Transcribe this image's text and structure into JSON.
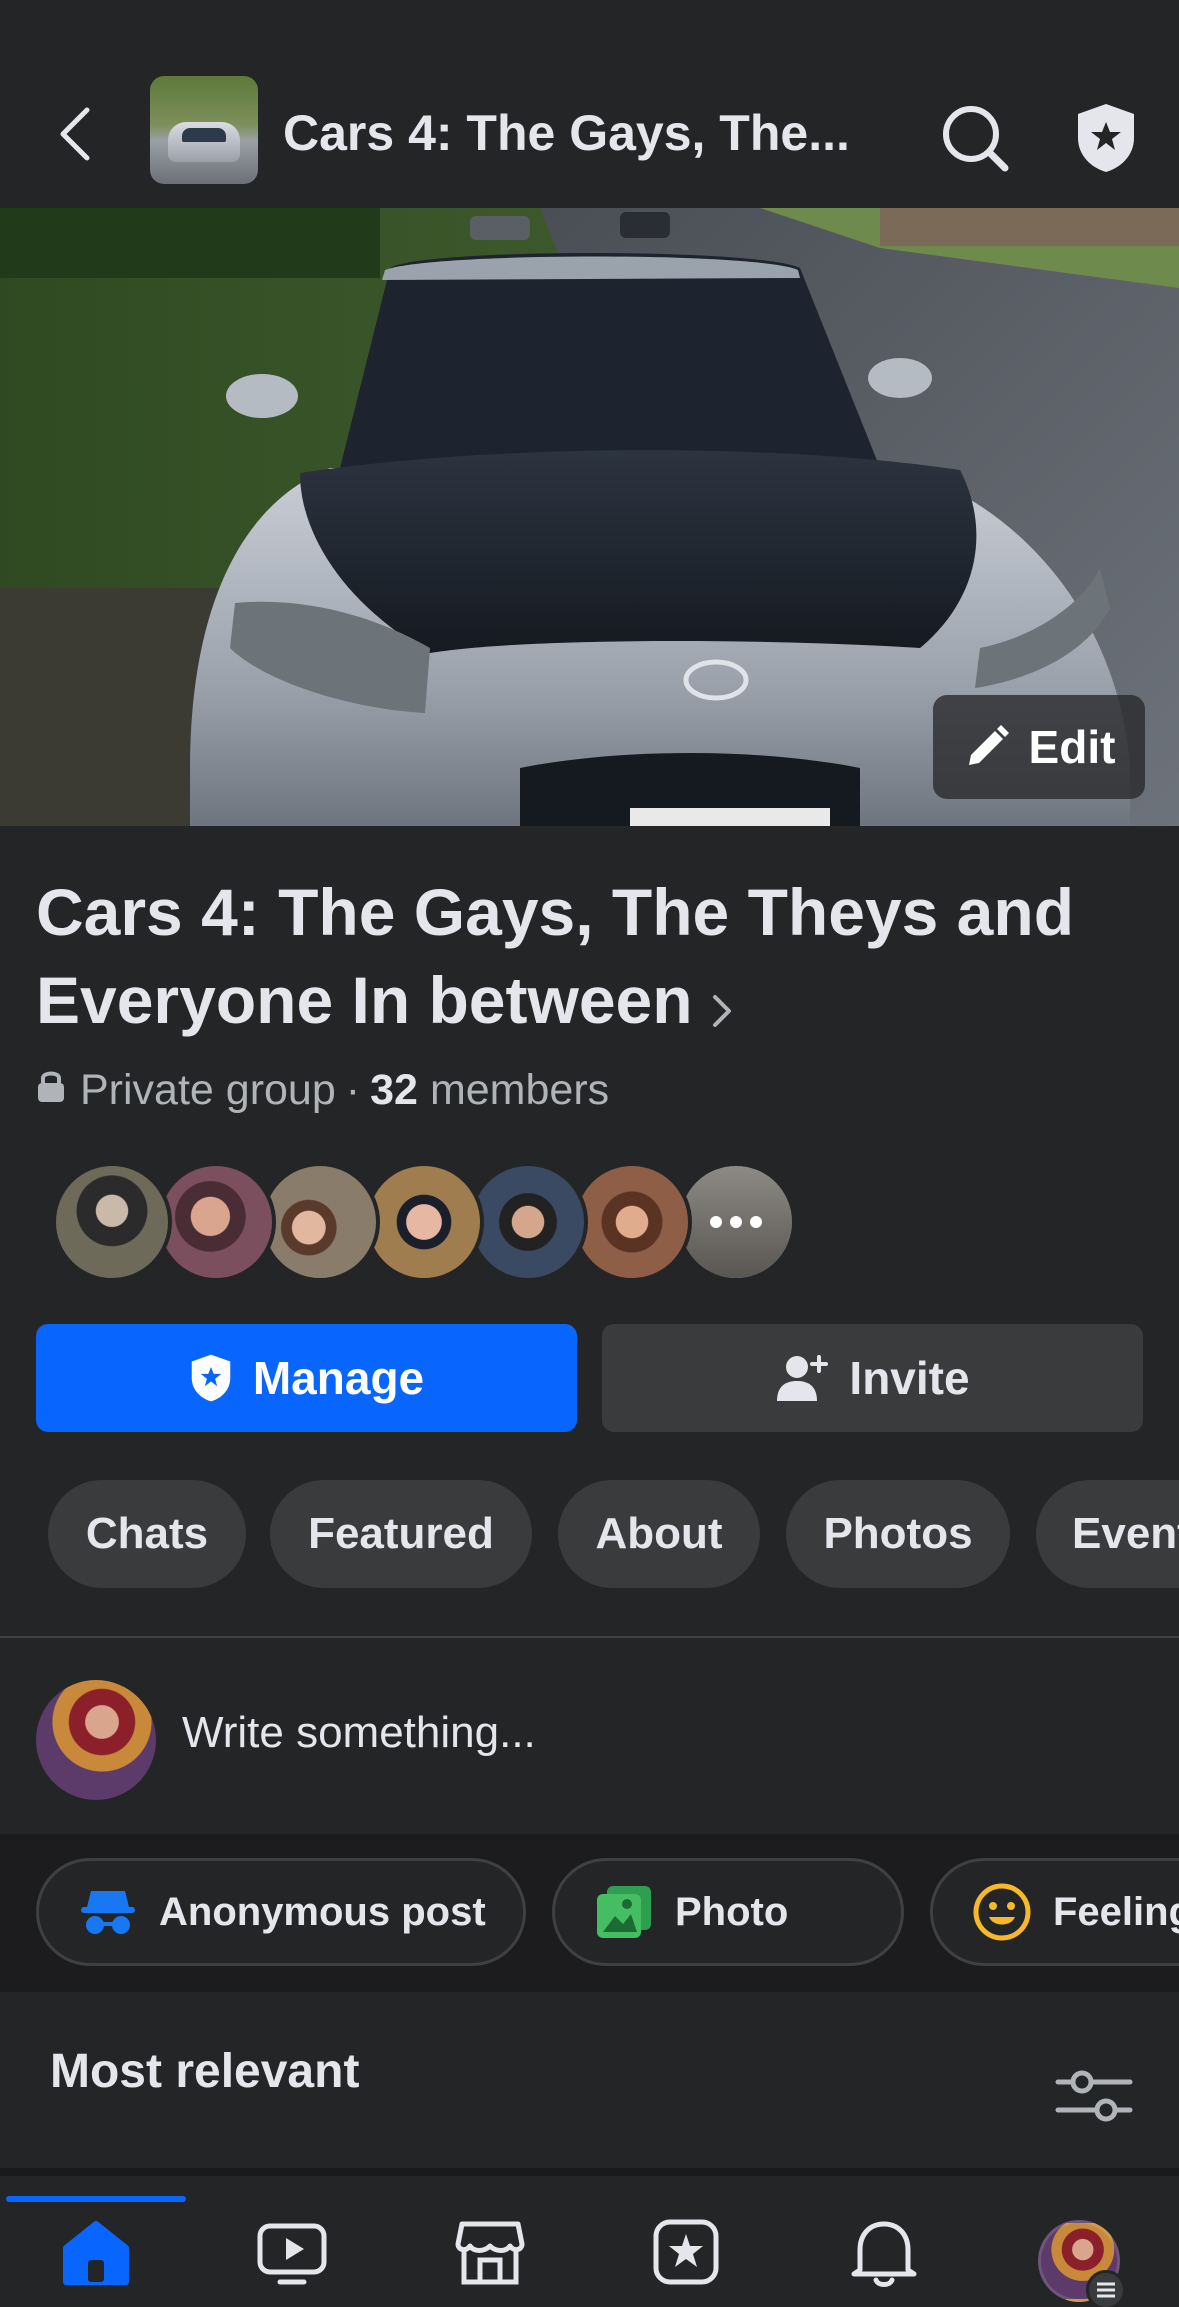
{
  "header": {
    "title": "Cars 4: The Gays, The..."
  },
  "cover": {
    "edit_label": "Edit"
  },
  "group": {
    "name": "Cars 4: The Gays, The Theys and Everyone In between",
    "privacy": "Private group",
    "member_count": "32",
    "members_suffix": "members"
  },
  "actions": {
    "manage_label": "Manage",
    "invite_label": "Invite"
  },
  "tabs": [
    {
      "label": "Chats"
    },
    {
      "label": "Featured"
    },
    {
      "label": "About"
    },
    {
      "label": "Photos"
    },
    {
      "label": "Events"
    }
  ],
  "composer": {
    "placeholder": "Write something..."
  },
  "post_actions": [
    {
      "label": "Anonymous post",
      "icon": "incognito-icon",
      "color": "#1877f2"
    },
    {
      "label": "Photo",
      "icon": "photo-icon",
      "color": "#45bd62"
    },
    {
      "label": "Feeling",
      "icon": "smiley-icon",
      "color": "#f7b928"
    }
  ],
  "feed": {
    "sort_label": "Most relevant"
  },
  "bottom_nav": [
    {
      "name": "home",
      "icon": "home-icon",
      "active": true
    },
    {
      "name": "video",
      "icon": "video-icon"
    },
    {
      "name": "marketplace",
      "icon": "marketplace-icon"
    },
    {
      "name": "feeds",
      "icon": "feeds-icon"
    },
    {
      "name": "notifications",
      "icon": "bell-icon"
    },
    {
      "name": "profile",
      "icon": "profile-avatar"
    }
  ],
  "colors": {
    "background": "#242526",
    "accent": "#0866ff",
    "button_secondary": "#3a3b3c",
    "text_primary": "#e4e6eb",
    "text_secondary": "#b0b3b8"
  }
}
